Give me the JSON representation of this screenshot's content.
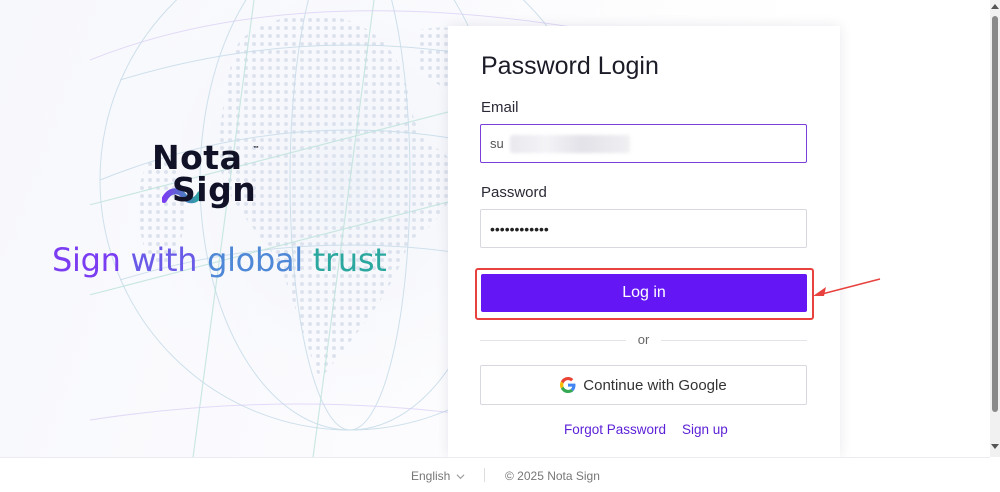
{
  "brand": {
    "logo_line1": "Nota",
    "logo_line2": "Sign",
    "logo_tm": "™",
    "tagline_words": [
      "Sign",
      "with",
      "global",
      "trust"
    ],
    "colors": {
      "primary": "#6416f5",
      "accent_teal": "#2aa89f",
      "highlight": "#e8423f"
    }
  },
  "login": {
    "title": "Password Login",
    "email_label": "Email",
    "email_value": "su",
    "password_label": "Password",
    "password_value": "••••••••••••",
    "login_button": "Log in",
    "or_text": "or",
    "google_button": "Continue with Google",
    "forgot_link": "Forgot Password",
    "signup_link": "Sign up"
  },
  "footer": {
    "language": "English",
    "copyright": "© 2025 Nota Sign"
  },
  "icons": {
    "google": "google-g-icon",
    "language_chevron": "chevron-down-icon",
    "annotation": "red-arrow-icon"
  }
}
